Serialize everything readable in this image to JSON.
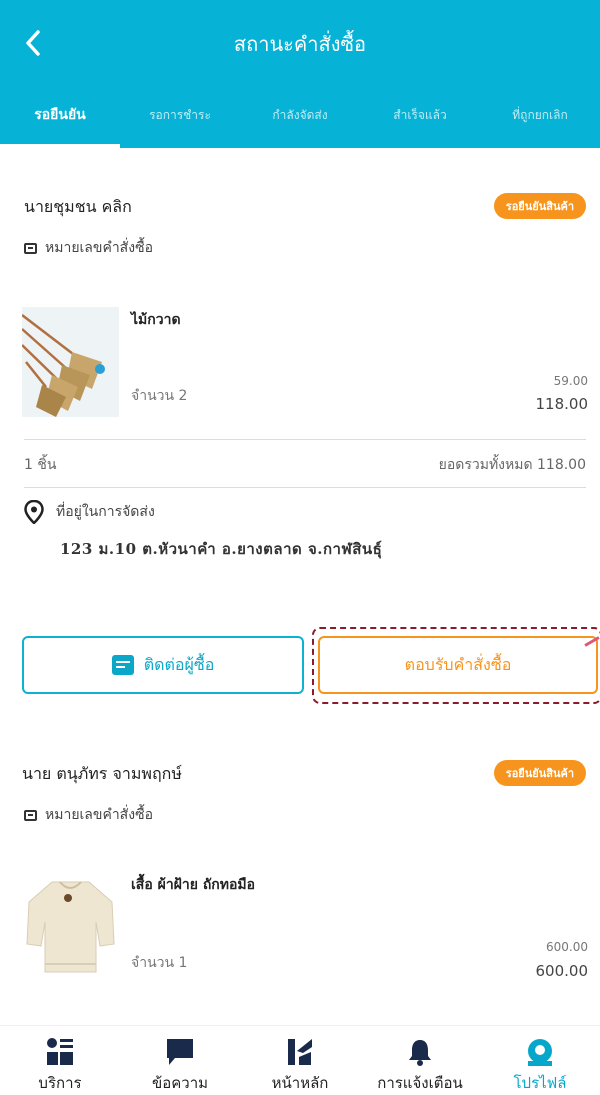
{
  "header": {
    "title": "สถานะคำสั่งซื้อ",
    "tabs": [
      {
        "label": "รอยืนยัน",
        "active": true
      },
      {
        "label": "รอการชำระ",
        "active": false
      },
      {
        "label": "กำลังจัดส่ง",
        "active": false
      },
      {
        "label": "สำเร็จแล้ว",
        "active": false
      },
      {
        "label": "ที่ถูกยกเลิก",
        "active": false
      }
    ]
  },
  "orders": [
    {
      "buyer": "นายชุมชน คลิก",
      "status_badge": "รอยืนยันสินค้า",
      "order_number_label": "หมายเลขคำสั่งซื้อ",
      "product": {
        "name": "ไม้กวาด",
        "image_icon": "broom-image",
        "quantity": "จำนวน 2",
        "unit_price": "59.00",
        "line_total": "118.00"
      },
      "summary": {
        "items": "1 ชิ้น",
        "total": "ยอดรวมทั้งหมด 118.00"
      },
      "shipping": {
        "label": "ที่อยู่ในการจัดส่ง",
        "address": "123 ม.10 ต.หัวนาคำ อ.ยางตลาด จ.กาฬสินธุ์"
      },
      "actions": {
        "contact_label": "ติดต่อผู้ซื้อ",
        "accept_label": "ตอบรับคำสั่งซื้อ"
      }
    },
    {
      "buyer": "นาย ตนุภัทร จามพฤกษ์",
      "status_badge": "รอยืนยันสินค้า",
      "order_number_label": "หมายเลขคำสั่งซื้อ",
      "product": {
        "name": "เสื้อ ผ้าฝ้าย ถักทอมือ",
        "image_icon": "shirt-image",
        "quantity": "จำนวน 1",
        "unit_price": "600.00",
        "line_total": "600.00"
      }
    }
  ],
  "bottom_nav": [
    {
      "label": "บริการ",
      "icon": "services-icon"
    },
    {
      "label": "ข้อความ",
      "icon": "message-icon"
    },
    {
      "label": "หน้าหลัก",
      "icon": "home-logo-icon"
    },
    {
      "label": "การแจ้งเตือน",
      "icon": "bell-icon"
    },
    {
      "label": "โปรไฟล์",
      "icon": "profile-icon",
      "active": true
    }
  ],
  "colors": {
    "primary": "#06b2d6",
    "accent": "#f7941d",
    "highlight": "#8b1a2a"
  }
}
